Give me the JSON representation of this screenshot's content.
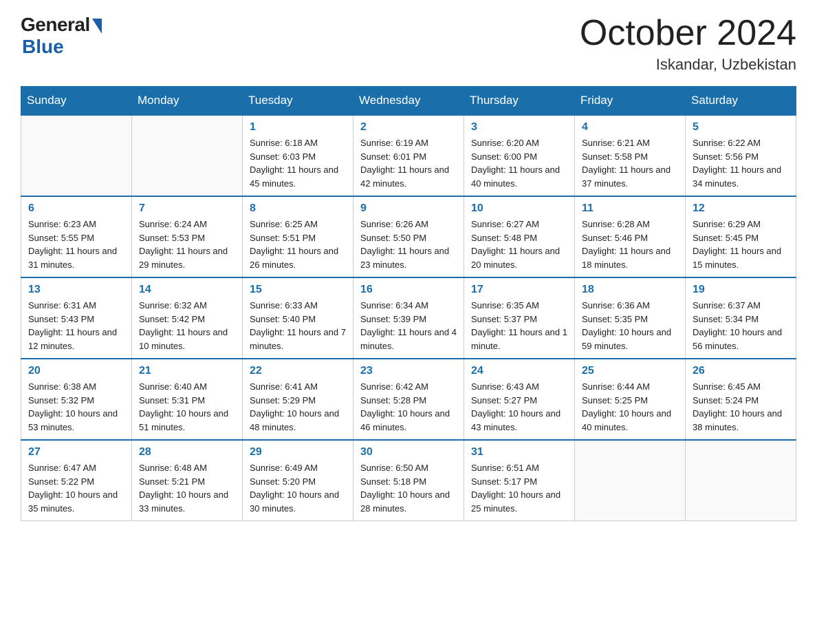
{
  "logo": {
    "general": "General",
    "blue": "Blue",
    "sub": "Blue"
  },
  "header": {
    "month_title": "October 2024",
    "location": "Iskandar, Uzbekistan"
  },
  "weekdays": [
    "Sunday",
    "Monday",
    "Tuesday",
    "Wednesday",
    "Thursday",
    "Friday",
    "Saturday"
  ],
  "weeks": [
    [
      {
        "day": "",
        "sunrise": "",
        "sunset": "",
        "daylight": ""
      },
      {
        "day": "",
        "sunrise": "",
        "sunset": "",
        "daylight": ""
      },
      {
        "day": "1",
        "sunrise": "Sunrise: 6:18 AM",
        "sunset": "Sunset: 6:03 PM",
        "daylight": "Daylight: 11 hours and 45 minutes."
      },
      {
        "day": "2",
        "sunrise": "Sunrise: 6:19 AM",
        "sunset": "Sunset: 6:01 PM",
        "daylight": "Daylight: 11 hours and 42 minutes."
      },
      {
        "day": "3",
        "sunrise": "Sunrise: 6:20 AM",
        "sunset": "Sunset: 6:00 PM",
        "daylight": "Daylight: 11 hours and 40 minutes."
      },
      {
        "day": "4",
        "sunrise": "Sunrise: 6:21 AM",
        "sunset": "Sunset: 5:58 PM",
        "daylight": "Daylight: 11 hours and 37 minutes."
      },
      {
        "day": "5",
        "sunrise": "Sunrise: 6:22 AM",
        "sunset": "Sunset: 5:56 PM",
        "daylight": "Daylight: 11 hours and 34 minutes."
      }
    ],
    [
      {
        "day": "6",
        "sunrise": "Sunrise: 6:23 AM",
        "sunset": "Sunset: 5:55 PM",
        "daylight": "Daylight: 11 hours and 31 minutes."
      },
      {
        "day": "7",
        "sunrise": "Sunrise: 6:24 AM",
        "sunset": "Sunset: 5:53 PM",
        "daylight": "Daylight: 11 hours and 29 minutes."
      },
      {
        "day": "8",
        "sunrise": "Sunrise: 6:25 AM",
        "sunset": "Sunset: 5:51 PM",
        "daylight": "Daylight: 11 hours and 26 minutes."
      },
      {
        "day": "9",
        "sunrise": "Sunrise: 6:26 AM",
        "sunset": "Sunset: 5:50 PM",
        "daylight": "Daylight: 11 hours and 23 minutes."
      },
      {
        "day": "10",
        "sunrise": "Sunrise: 6:27 AM",
        "sunset": "Sunset: 5:48 PM",
        "daylight": "Daylight: 11 hours and 20 minutes."
      },
      {
        "day": "11",
        "sunrise": "Sunrise: 6:28 AM",
        "sunset": "Sunset: 5:46 PM",
        "daylight": "Daylight: 11 hours and 18 minutes."
      },
      {
        "day": "12",
        "sunrise": "Sunrise: 6:29 AM",
        "sunset": "Sunset: 5:45 PM",
        "daylight": "Daylight: 11 hours and 15 minutes."
      }
    ],
    [
      {
        "day": "13",
        "sunrise": "Sunrise: 6:31 AM",
        "sunset": "Sunset: 5:43 PM",
        "daylight": "Daylight: 11 hours and 12 minutes."
      },
      {
        "day": "14",
        "sunrise": "Sunrise: 6:32 AM",
        "sunset": "Sunset: 5:42 PM",
        "daylight": "Daylight: 11 hours and 10 minutes."
      },
      {
        "day": "15",
        "sunrise": "Sunrise: 6:33 AM",
        "sunset": "Sunset: 5:40 PM",
        "daylight": "Daylight: 11 hours and 7 minutes."
      },
      {
        "day": "16",
        "sunrise": "Sunrise: 6:34 AM",
        "sunset": "Sunset: 5:39 PM",
        "daylight": "Daylight: 11 hours and 4 minutes."
      },
      {
        "day": "17",
        "sunrise": "Sunrise: 6:35 AM",
        "sunset": "Sunset: 5:37 PM",
        "daylight": "Daylight: 11 hours and 1 minute."
      },
      {
        "day": "18",
        "sunrise": "Sunrise: 6:36 AM",
        "sunset": "Sunset: 5:35 PM",
        "daylight": "Daylight: 10 hours and 59 minutes."
      },
      {
        "day": "19",
        "sunrise": "Sunrise: 6:37 AM",
        "sunset": "Sunset: 5:34 PM",
        "daylight": "Daylight: 10 hours and 56 minutes."
      }
    ],
    [
      {
        "day": "20",
        "sunrise": "Sunrise: 6:38 AM",
        "sunset": "Sunset: 5:32 PM",
        "daylight": "Daylight: 10 hours and 53 minutes."
      },
      {
        "day": "21",
        "sunrise": "Sunrise: 6:40 AM",
        "sunset": "Sunset: 5:31 PM",
        "daylight": "Daylight: 10 hours and 51 minutes."
      },
      {
        "day": "22",
        "sunrise": "Sunrise: 6:41 AM",
        "sunset": "Sunset: 5:29 PM",
        "daylight": "Daylight: 10 hours and 48 minutes."
      },
      {
        "day": "23",
        "sunrise": "Sunrise: 6:42 AM",
        "sunset": "Sunset: 5:28 PM",
        "daylight": "Daylight: 10 hours and 46 minutes."
      },
      {
        "day": "24",
        "sunrise": "Sunrise: 6:43 AM",
        "sunset": "Sunset: 5:27 PM",
        "daylight": "Daylight: 10 hours and 43 minutes."
      },
      {
        "day": "25",
        "sunrise": "Sunrise: 6:44 AM",
        "sunset": "Sunset: 5:25 PM",
        "daylight": "Daylight: 10 hours and 40 minutes."
      },
      {
        "day": "26",
        "sunrise": "Sunrise: 6:45 AM",
        "sunset": "Sunset: 5:24 PM",
        "daylight": "Daylight: 10 hours and 38 minutes."
      }
    ],
    [
      {
        "day": "27",
        "sunrise": "Sunrise: 6:47 AM",
        "sunset": "Sunset: 5:22 PM",
        "daylight": "Daylight: 10 hours and 35 minutes."
      },
      {
        "day": "28",
        "sunrise": "Sunrise: 6:48 AM",
        "sunset": "Sunset: 5:21 PM",
        "daylight": "Daylight: 10 hours and 33 minutes."
      },
      {
        "day": "29",
        "sunrise": "Sunrise: 6:49 AM",
        "sunset": "Sunset: 5:20 PM",
        "daylight": "Daylight: 10 hours and 30 minutes."
      },
      {
        "day": "30",
        "sunrise": "Sunrise: 6:50 AM",
        "sunset": "Sunset: 5:18 PM",
        "daylight": "Daylight: 10 hours and 28 minutes."
      },
      {
        "day": "31",
        "sunrise": "Sunrise: 6:51 AM",
        "sunset": "Sunset: 5:17 PM",
        "daylight": "Daylight: 10 hours and 25 minutes."
      },
      {
        "day": "",
        "sunrise": "",
        "sunset": "",
        "daylight": ""
      },
      {
        "day": "",
        "sunrise": "",
        "sunset": "",
        "daylight": ""
      }
    ]
  ]
}
